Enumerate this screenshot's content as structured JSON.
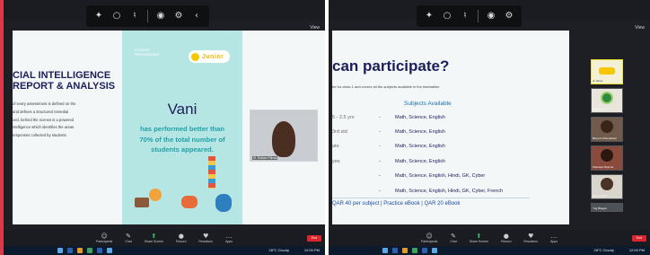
{
  "left_window": {
    "top_toolbar_icons": [
      "zoom-icon",
      "circle-icon",
      "mic-icon",
      "record-icon",
      "settings-icon",
      "chevron-left-icon"
    ],
    "view_label": "View",
    "slide": {
      "ai_title_line1": "CIAL INTELLIGENCE",
      "ai_title_line2": "REPORT & ANALYSIS",
      "ai_paragraph_lines": [
        "of every assessment is defined on the",
        "and defines a structured remedial",
        "ced, behind the scenes is a powered",
        "ntelligence which identifies the areas",
        "responses collected by students."
      ],
      "card": {
        "tag": "STUDENT PERFORMANCE",
        "logo_text": "Junior",
        "student_name": "Vani",
        "message_lines": [
          "has performed better than",
          "70% of the total number of",
          "students appeared."
        ]
      }
    },
    "video_name": "Dr. Rashmi Pahwa",
    "bottom_items": [
      {
        "glyph": "☺",
        "label": "Participants"
      },
      {
        "glyph": "✎",
        "label": "Chat"
      },
      {
        "glyph": "⬆",
        "label": "Share Screen"
      },
      {
        "glyph": "●",
        "label": "Record"
      },
      {
        "glyph": "♥",
        "label": "Reactions"
      },
      {
        "glyph": "…",
        "label": "Apps"
      }
    ],
    "end_button": "End",
    "taskbar_weather": "28°C Cloudy",
    "taskbar_time": "12:00 PM"
  },
  "right_window": {
    "top_toolbar_icons": [
      "zoom-icon",
      "circle-icon",
      "mic-icon",
      "record-icon",
      "settings-icon"
    ],
    "view_label": "View",
    "slide": {
      "title": "can participate?",
      "subtitle": "be for class 1 and covers all the subjects available in the timetables",
      "subjects_header": "Subjects Available",
      "rows": [
        {
          "grade": "5 - 2.5 yrs",
          "dash": "-",
          "subjects": "Math, Science, English"
        },
        {
          "grade": "3rd std",
          "dash": "-",
          "subjects": "Math, Science, English"
        },
        {
          "grade": "ate",
          "dash": "-",
          "subjects": "Math, Science, English"
        },
        {
          "grade": "yes",
          "dash": "-",
          "subjects": "Math, Science, English"
        },
        {
          "grade": "",
          "dash": "-",
          "subjects": "Math, Science, English, Hindi, GK, Cyber"
        },
        {
          "grade": "",
          "dash": "-",
          "subjects": "Math, Science, English, Hindi, GK, Cyber, French"
        }
      ],
      "qar_line": "QAR 40 per subject  |  Practice eBook | QAR 20 eBook"
    },
    "gallery_names": [
      "Jr Junior",
      "Student 1",
      "Bhoomi Khandelwal",
      "Shanaya Sharma",
      "Shreya Jain",
      "Yug Bhagat"
    ],
    "bottom_items": [
      {
        "glyph": "☺",
        "label": "Participants"
      },
      {
        "glyph": "✎",
        "label": "Chat"
      },
      {
        "glyph": "⬆",
        "label": "Share Screen"
      },
      {
        "glyph": "●",
        "label": "Record"
      },
      {
        "glyph": "♥",
        "label": "Reactions"
      },
      {
        "glyph": "…",
        "label": "Apps"
      }
    ],
    "end_button": "End",
    "taskbar_weather": "28°C Cloudy",
    "taskbar_time": "12:00 PM"
  },
  "colors": {
    "accent_red": "#d83a4c",
    "navy_text": "#1c1f5a",
    "teal_card": "#b6e6e4",
    "teal_text": "#21a1a8",
    "end_red": "#d9252f"
  }
}
